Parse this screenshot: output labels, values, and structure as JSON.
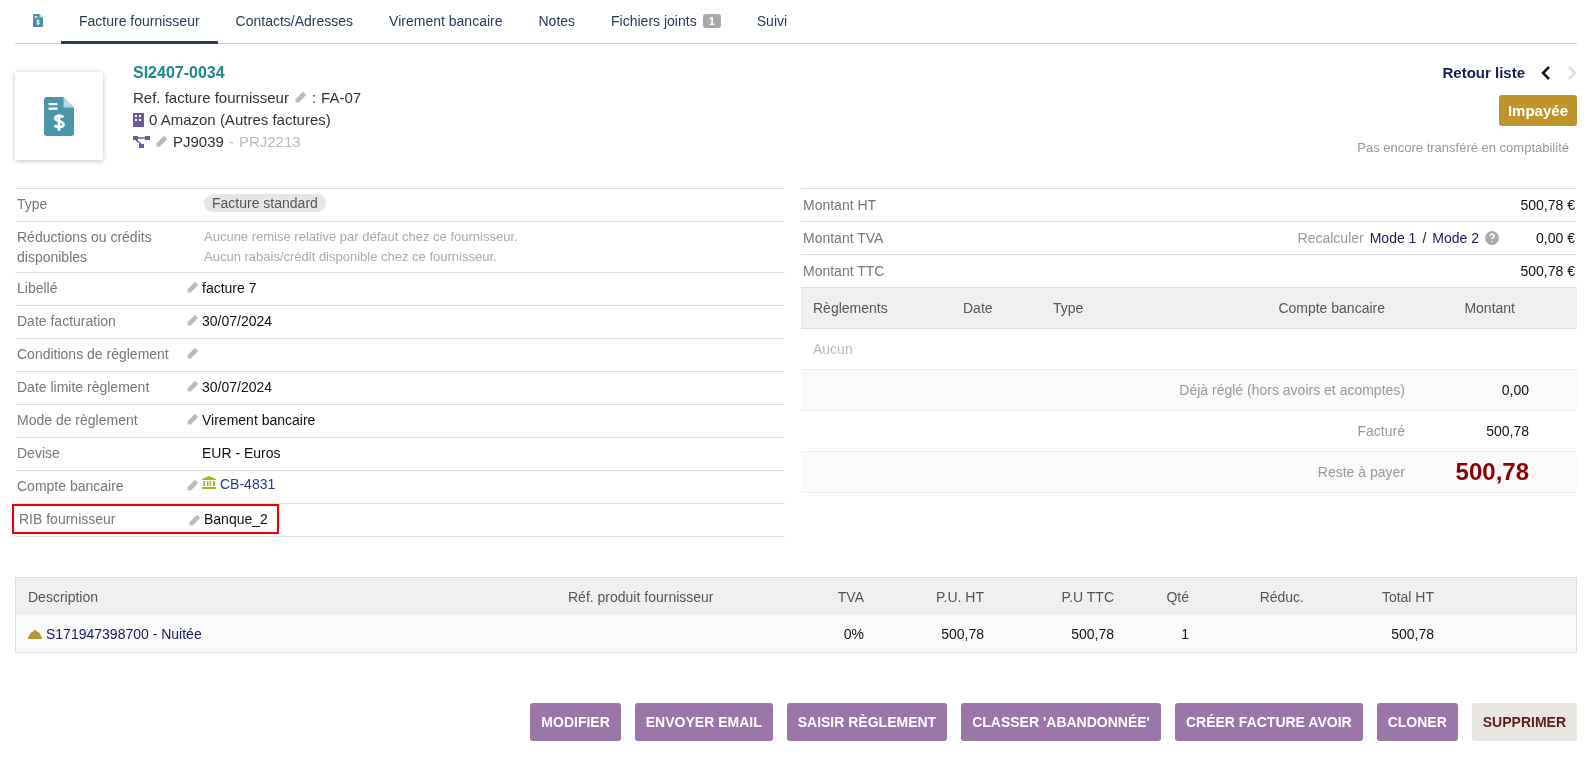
{
  "tabs": [
    {
      "kind": "icon",
      "selected": false
    },
    {
      "label": "Facture fournisseur",
      "selected": true
    },
    {
      "label": "Contacts/Adresses",
      "selected": false
    },
    {
      "label": "Virement bancaire",
      "selected": false
    },
    {
      "label": "Notes",
      "selected": false
    },
    {
      "label": "Fichiers joints",
      "count": "1",
      "selected": false
    },
    {
      "label": "Suivi",
      "selected": false
    }
  ],
  "header": {
    "ref": "SI2407-0034",
    "supplier_ref_label": "Ref. facture fournisseur",
    "supplier_ref_separator": ":",
    "supplier_ref": "FA-07",
    "supplier": "0 Amazon (Autres factures)",
    "project": "PJ9039",
    "project_separator": "-",
    "project_name": "PRJ2213",
    "back_link": "Retour liste",
    "status": "Impayée",
    "accounting_note": "Pas encore transféré en comptabilité"
  },
  "fields": [
    {
      "label": "Type",
      "kind": "badge",
      "value": "Facture standard",
      "editable": false,
      "highlighted": false
    },
    {
      "label": "Réductions ou crédits disponibles",
      "kind": "muted",
      "lines": [
        "Aucune remise relative par défaut chez ce fournisseur.",
        "Aucun rabais/crédit disponible chez ce fournisseur."
      ],
      "editable": false,
      "highlighted": false
    },
    {
      "label": "Libellé",
      "kind": "text",
      "value": "facture 7",
      "editable": true,
      "highlighted": false
    },
    {
      "label": "Date facturation",
      "kind": "text",
      "value": "30/07/2024",
      "editable": true,
      "highlighted": false
    },
    {
      "label": "Conditions de règlement",
      "kind": "text",
      "editable": true,
      "highlighted": false
    },
    {
      "label": "Date limite règlement",
      "kind": "text",
      "value": "30/07/2024",
      "editable": true,
      "highlighted": false
    },
    {
      "label": "Mode de règlement",
      "kind": "text",
      "value": "Virement bancaire",
      "editable": true,
      "highlighted": false
    },
    {
      "label": "Devise",
      "kind": "text",
      "value": "EUR - Euros",
      "editable": false,
      "highlighted": false
    },
    {
      "label": "Compte bancaire",
      "kind": "bank",
      "value": "CB-4831",
      "editable": true,
      "highlighted": false
    },
    {
      "label": "RIB fournisseur",
      "kind": "text",
      "value": "Banque_2",
      "editable": true,
      "highlighted": true
    }
  ],
  "amounts": [
    {
      "label": "Montant HT",
      "value": "500,78 €"
    },
    {
      "label": "Montant TVA",
      "recalc": {
        "label": "Recalculer",
        "mode1": "Mode 1",
        "separator": "/",
        "mode2": "Mode 2"
      },
      "value": "0,00 €"
    },
    {
      "label": "Montant TTC",
      "value": "500,78 €"
    }
  ],
  "payments": {
    "columns": [
      "Règlements",
      "Date",
      "Type",
      "Compte bancaire",
      "Montant"
    ],
    "empty": "Aucun",
    "summary": [
      {
        "label": "Déjà réglé (hors avoirs et acomptes)",
        "value": "0,00",
        "kind": "normal"
      },
      {
        "label": "Facturé",
        "value": "500,78",
        "kind": "normal"
      },
      {
        "label": "Reste à payer",
        "value": "500,78",
        "kind": "total"
      }
    ]
  },
  "lines": {
    "columns": [
      "Description",
      "Réf. produit fournisseur",
      "TVA",
      "P.U. HT",
      "P.U TTC",
      "Qté",
      "Réduc.",
      "Total HT"
    ],
    "rows": [
      {
        "description": "S171947398700 - Nuitée",
        "tva": "0%",
        "pu_ht": "500,78",
        "pu_ttc": "500,78",
        "qty": "1",
        "total": "500,78"
      }
    ]
  },
  "actions": [
    {
      "label": "MODIFIER",
      "kind": "primary"
    },
    {
      "label": "ENVOYER EMAIL",
      "kind": "primary"
    },
    {
      "label": "SAISIR RÈGLEMENT",
      "kind": "primary"
    },
    {
      "label": "CLASSER 'ABANDONNÉE'",
      "kind": "primary"
    },
    {
      "label": "CRÉER FACTURE AVOIR",
      "kind": "primary"
    },
    {
      "label": "CLONER",
      "kind": "primary"
    },
    {
      "label": "SUPPRIMER",
      "kind": "delete"
    }
  ]
}
